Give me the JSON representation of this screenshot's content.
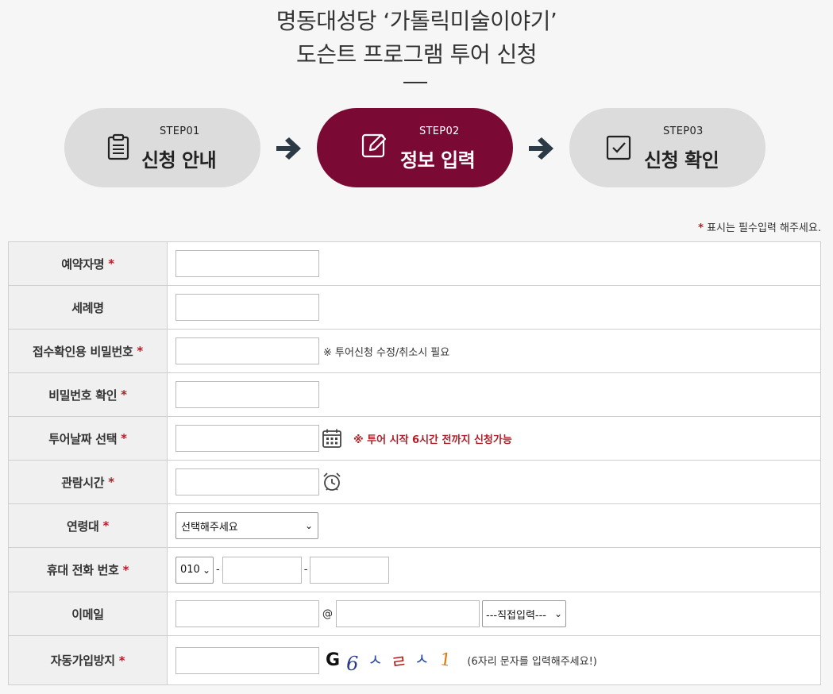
{
  "header": {
    "title_line1": "명동대성당 ‘가톨릭미술이야기’",
    "title_line2": "도슨트 프로그램 투어 신청"
  },
  "steps": [
    {
      "no": "STEP01",
      "title": "신청 안내",
      "icon": "clipboard-icon",
      "active": false
    },
    {
      "no": "STEP02",
      "title": "정보 입력",
      "icon": "edit-icon",
      "active": true
    },
    {
      "no": "STEP03",
      "title": "신청 확인",
      "icon": "checkbox-icon",
      "active": false
    }
  ],
  "colors": {
    "accent": "#7a0a34",
    "inactive_step": "#dcdcdc",
    "required": "#b0202a",
    "arrow": "#2b3a45"
  },
  "required_note": {
    "star": "*",
    "text": "표시는 필수입력 해주세요."
  },
  "form": {
    "name_label": "예약자명",
    "baptismal_label": "세례명",
    "password_label": "접수확인용 비밀번호",
    "password_note": "※ 투어신청 수정/취소시 필요",
    "password_confirm_label": "비밀번호 확인",
    "tour_date_label": "투어날짜 선택",
    "tour_date_note": "※ 투어 시작 6시간 전까지 신청가능",
    "view_time_label": "관람시간",
    "age_label": "연령대",
    "age_select_value": "선택해주세요",
    "phone_label": "휴대 전화 번호",
    "phone_prefix_value": "010",
    "phone_dash": "-",
    "email_label": "이메일",
    "email_at": "@",
    "email_domain_value": "---직접입력---",
    "captcha_label": "자동가입방지",
    "captcha_chars": [
      "G",
      "6",
      "ㅅ",
      "ㄹ",
      "ㅅ",
      "1"
    ],
    "captcha_note": "(6자리 문자를 입력해주세요!)",
    "required_star": "*"
  }
}
